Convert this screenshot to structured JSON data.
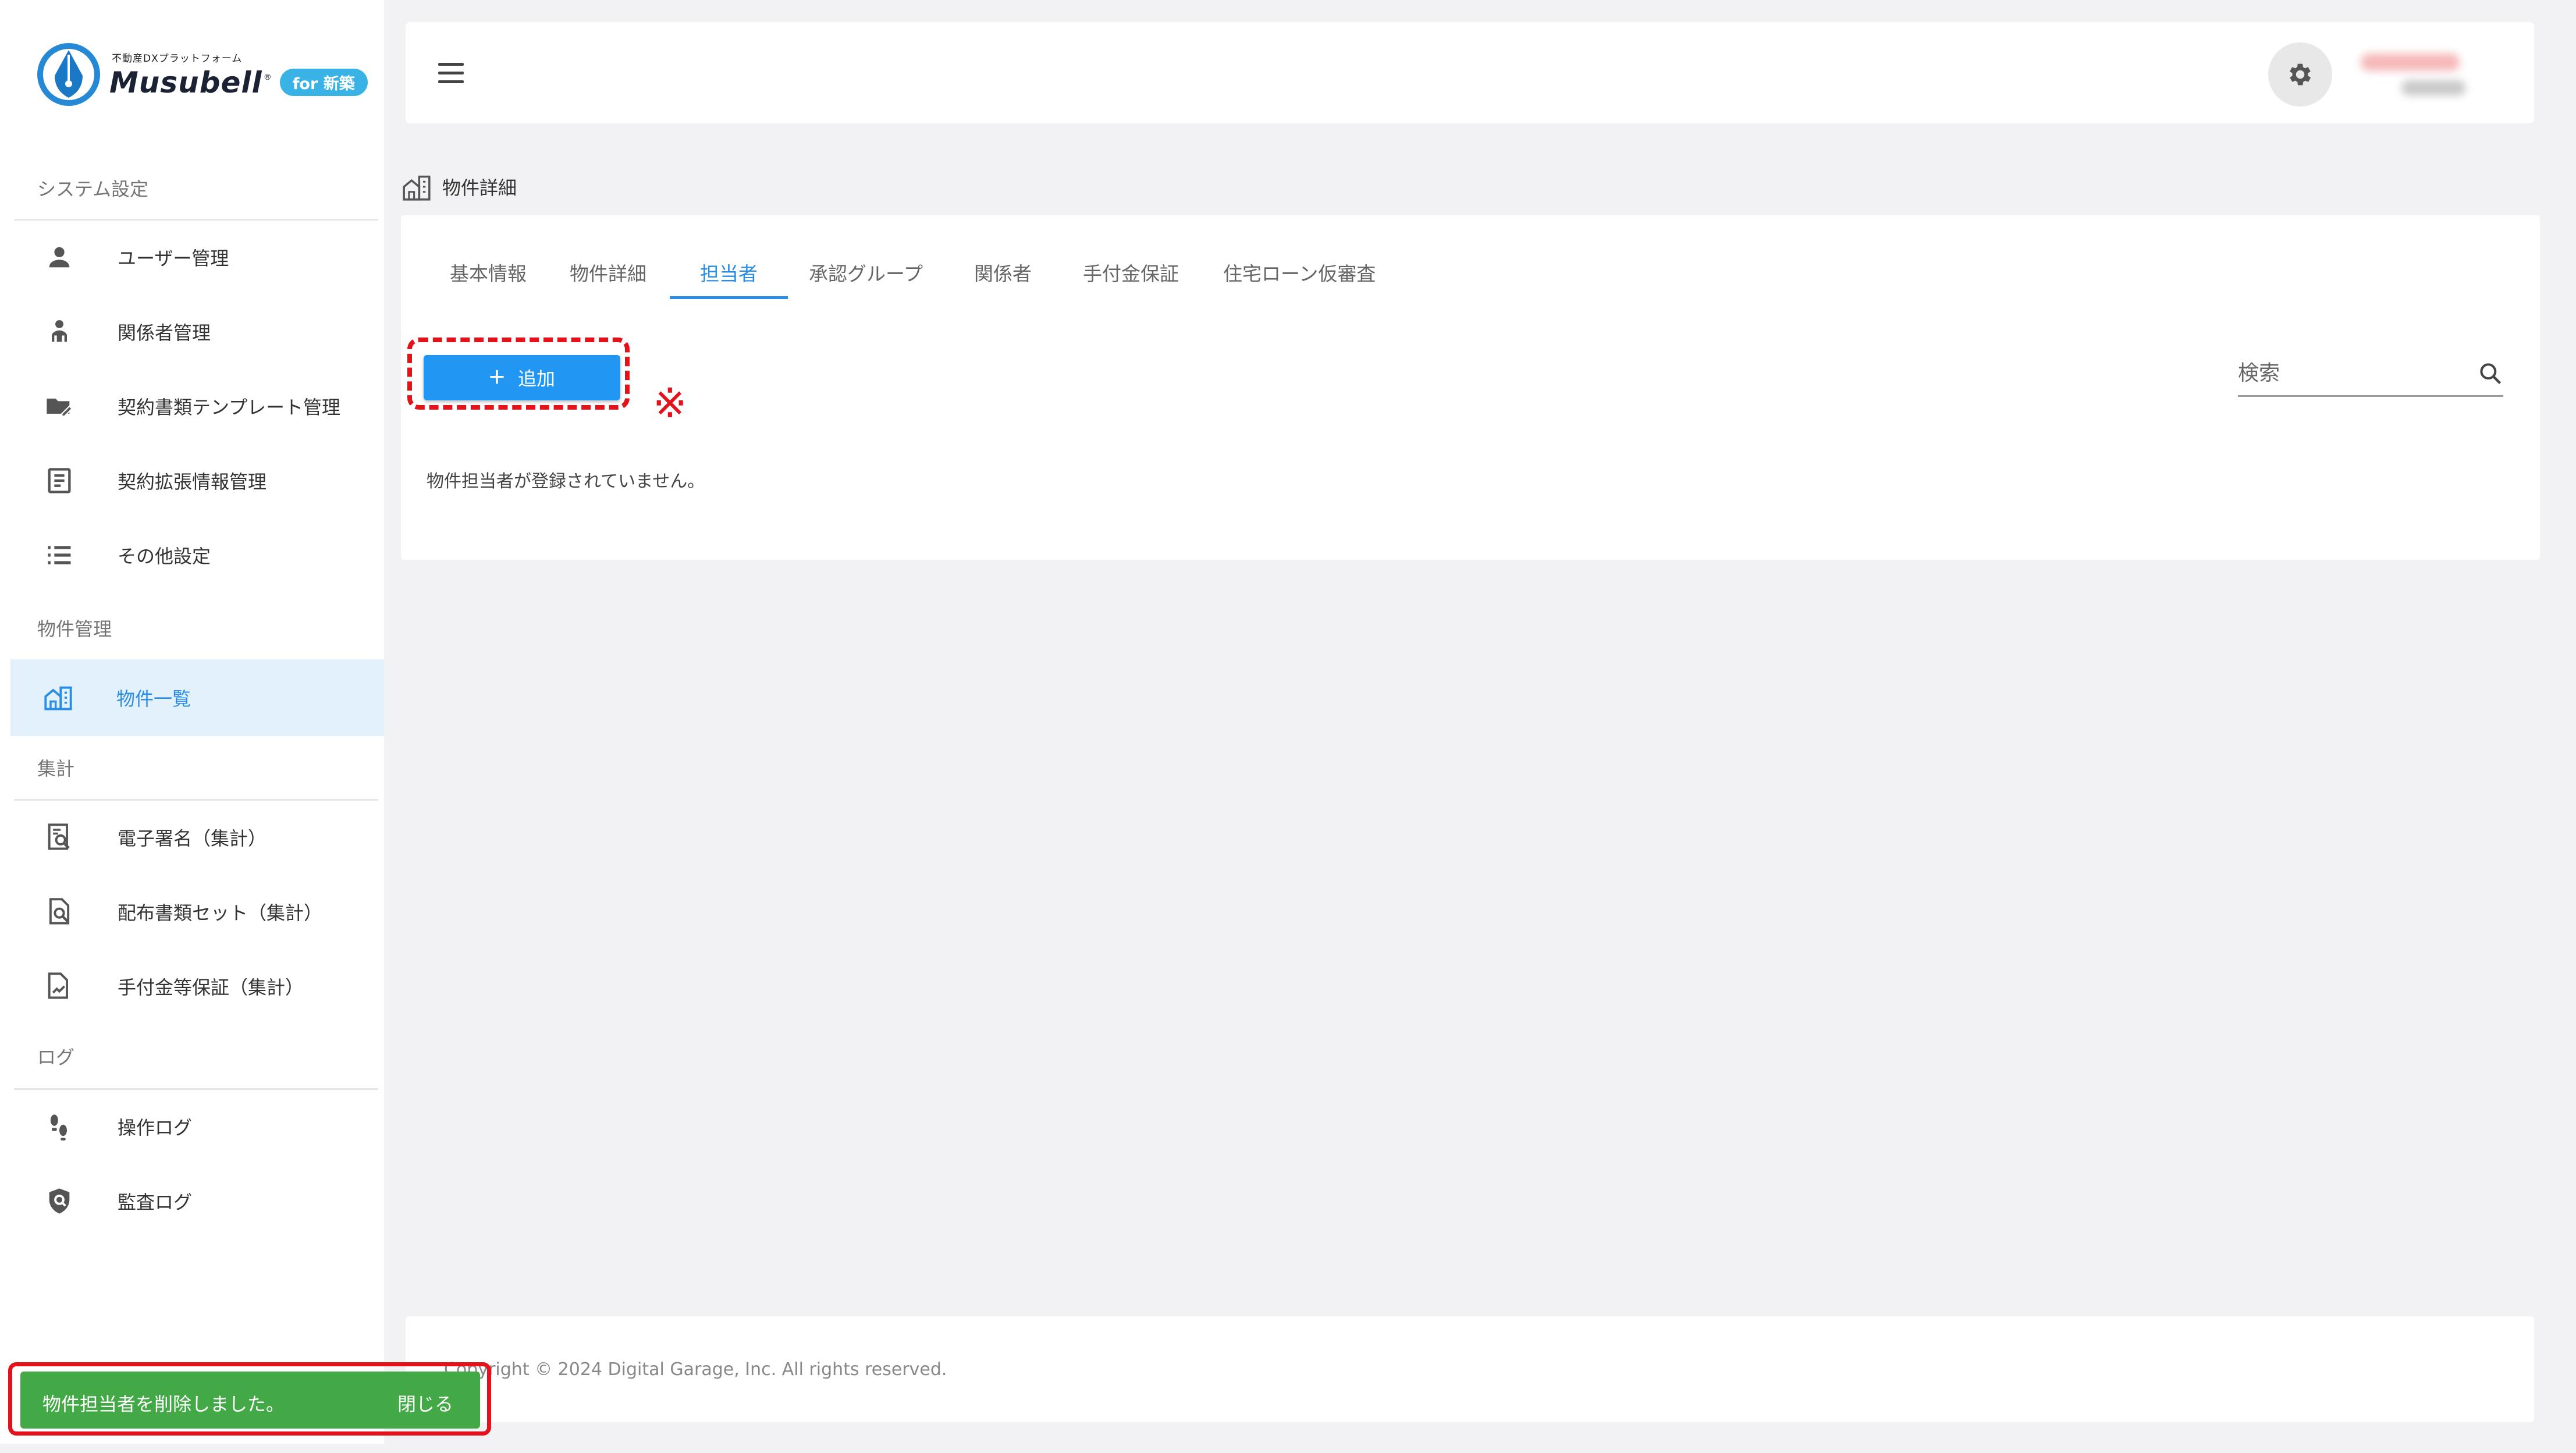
{
  "brand": {
    "tagline": "不動産DXプラットフォーム",
    "name": "Musubell",
    "reg_mark": "®",
    "badge": "for 新築",
    "color": "#39b3e6"
  },
  "sidebar": {
    "sections": [
      {
        "label": "システム設定",
        "items": [
          {
            "label": "ユーザー管理",
            "icon": "person-icon"
          },
          {
            "label": "関係者管理",
            "icon": "people-icon"
          },
          {
            "label": "契約書類テンプレート管理",
            "icon": "folder-edit-icon"
          },
          {
            "label": "契約拡張情報管理",
            "icon": "document-list-icon"
          },
          {
            "label": "その他設定",
            "icon": "list-icon"
          }
        ]
      },
      {
        "label": "物件管理",
        "items": [
          {
            "label": "物件一覧",
            "icon": "building-icon",
            "active": true
          }
        ]
      },
      {
        "label": "集計",
        "items": [
          {
            "label": "電子署名（集計）",
            "icon": "document-search-icon"
          },
          {
            "label": "配布書類セット（集計）",
            "icon": "file-search-icon"
          },
          {
            "label": "手付金等保証（集計）",
            "icon": "file-chart-icon"
          }
        ]
      },
      {
        "label": "ログ",
        "items": [
          {
            "label": "操作ログ",
            "icon": "footprints-icon"
          },
          {
            "label": "監査ログ",
            "icon": "shield-search-icon"
          }
        ]
      }
    ],
    "active_color": "#2a8ee6",
    "active_bg": "#e3f1fc"
  },
  "header": {
    "menu_icon": "hamburger-icon",
    "settings_icon": "gear-icon"
  },
  "breadcrumb": {
    "icon": "building-icon",
    "label": "物件詳細"
  },
  "tabs": [
    {
      "label": "基本情報"
    },
    {
      "label": "物件詳細"
    },
    {
      "label": "担当者",
      "active": true
    },
    {
      "label": "承認グループ"
    },
    {
      "label": "関係者"
    },
    {
      "label": "手付金保証"
    },
    {
      "label": "住宅ローン仮審査"
    }
  ],
  "toolbar": {
    "add_label": "追加",
    "add_icon": "plus-icon",
    "note_mark": "※",
    "search_placeholder": "検索",
    "search_icon": "search-icon"
  },
  "content": {
    "empty_message": "物件担当者が登録されていません。"
  },
  "footer": {
    "copyright": "Copyright © 2024 Digital Garage, Inc. All rights reserved."
  },
  "snackbar": {
    "message": "物件担当者を削除しました。",
    "close_label": "閉じる",
    "color": "#43a946"
  },
  "highlight_color": "#e4121b"
}
